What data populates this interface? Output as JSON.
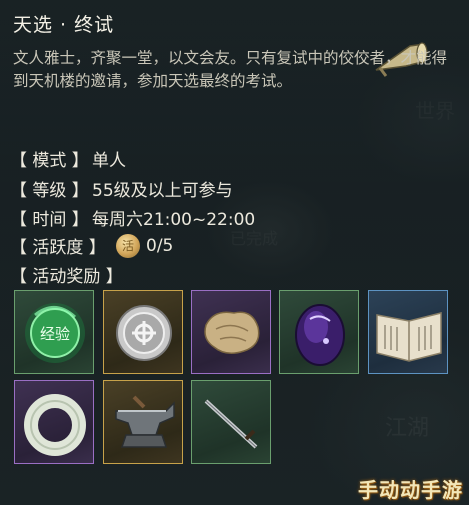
{
  "event": {
    "title": "天选 · 终试",
    "description": "文人雅士，齐聚一堂，以文会友。只有复试中的佼佼者，才能得到天机楼的邀请，参加天选最终的考试。"
  },
  "info": {
    "mode": {
      "key": "【 模式 】",
      "value": "单人"
    },
    "level": {
      "key": "【 等级 】",
      "value": "55级及以上可参与"
    },
    "time": {
      "key": "【 时间 】",
      "value": "每周六21:00~22:00"
    },
    "activity": {
      "key": "【 活跃度 】",
      "value": "0/5"
    }
  },
  "rewards": {
    "heading": "【 活动奖励 】",
    "items": [
      {
        "icon": "jade-exp-orb-icon",
        "quality": "green"
      },
      {
        "icon": "silver-coin-icon",
        "quality": "gold"
      },
      {
        "icon": "bone-fragment-icon",
        "quality": "purple"
      },
      {
        "icon": "purple-gem-icon",
        "quality": "green"
      },
      {
        "icon": "open-book-icon",
        "quality": "blue"
      },
      {
        "icon": "jade-ring-icon",
        "quality": "purple"
      },
      {
        "icon": "anvil-icon",
        "quality": "gold"
      },
      {
        "icon": "sword-icon",
        "quality": "green"
      }
    ]
  },
  "colors": {
    "quality_green": "#6a9f6e",
    "quality_gold": "#c7a24a",
    "quality_purple": "#9a6fc4",
    "quality_blue": "#5d93c2"
  },
  "watermark": "手动动手游"
}
